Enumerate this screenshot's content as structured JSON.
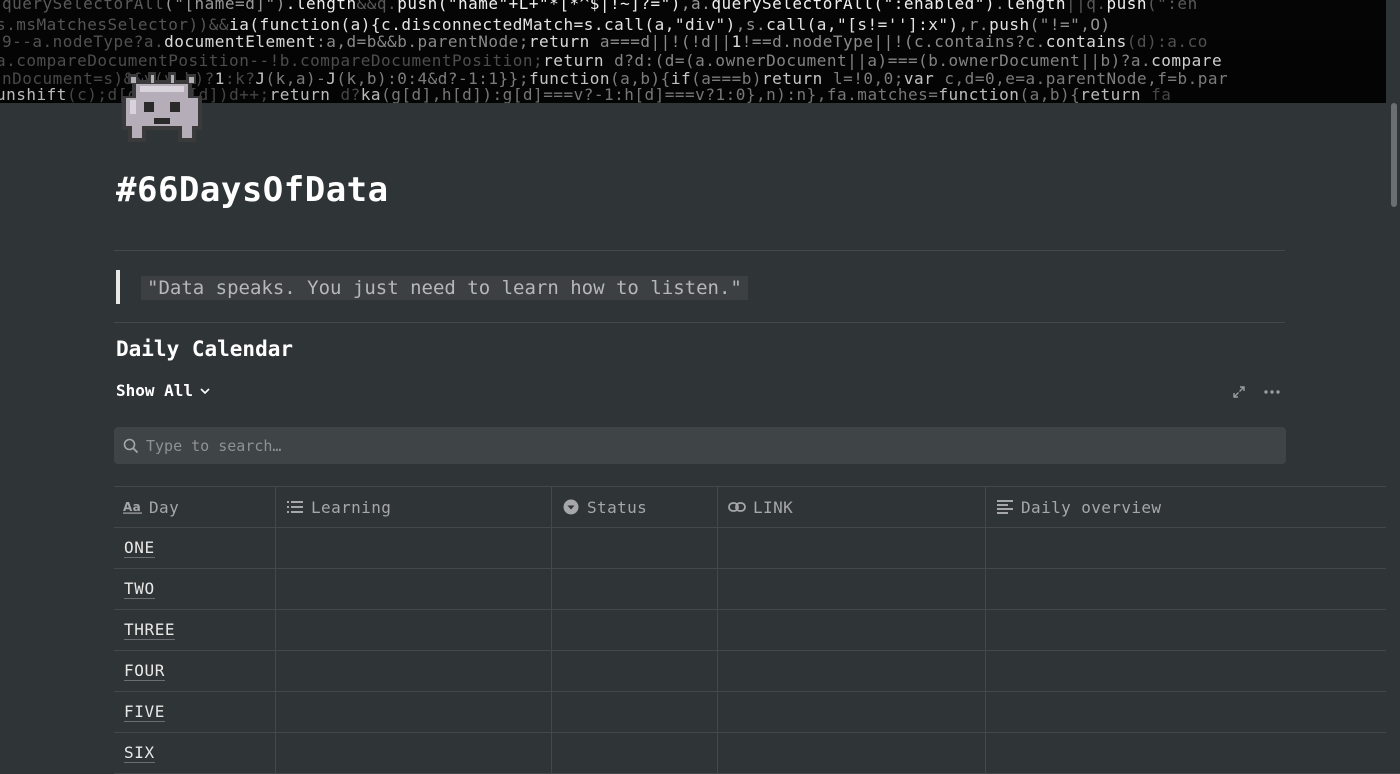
{
  "cover": {
    "code_lines": [
      [
        [
          "dim",
          "  querySelectorAll"
        ],
        [
          "mid",
          "(\"[name=d]\")"
        ],
        [
          "",
          "."
        ],
        [
          "",
          "length"
        ],
        [
          "dim",
          "&&q."
        ],
        [
          "",
          "push"
        ],
        [
          "",
          "(\"name\"+L+\"*[*^$|!~]?=\")"
        ],
        [
          "mid",
          ",a."
        ],
        [
          "",
          "querySelectorAll"
        ],
        [
          "",
          "(\":enabled\")"
        ],
        [
          "mid",
          "."
        ],
        [
          "",
          "length"
        ],
        [
          "dim",
          "||q."
        ],
        [
          "",
          "push"
        ],
        [
          "dim",
          "(\":en"
        ]
      ],
      [
        [
          "dim",
          "s.msMatchesSelector))&&"
        ],
        [
          "",
          "ia"
        ],
        [
          "",
          "(function(a){c.disconnectedMatch=s."
        ],
        [
          "",
          "call"
        ],
        [
          "",
          "(a,\"div\")"
        ],
        [
          "mid",
          ",s."
        ],
        [
          "",
          "call"
        ],
        [
          "",
          "(a,\"[s!='']:x\")"
        ],
        [
          "mid",
          ",r."
        ],
        [
          "",
          "push"
        ],
        [
          "mid",
          "(\"!=\",O)"
        ]
      ],
      [
        [
          "dim",
          "9--a.nodeType?a."
        ],
        [
          "",
          "documentElement"
        ],
        [
          "mid",
          ":a,d=b&&b.parentNode;"
        ],
        [
          "",
          "return"
        ],
        [
          "mid",
          " a===d||!(!d||"
        ],
        [
          "",
          "1"
        ],
        [
          "mid",
          "!==d.nodeType||!(c.contains?c."
        ],
        [
          "",
          "contains"
        ],
        [
          "dim",
          "(d):a.co"
        ]
      ],
      [
        [
          "dim",
          "  a.compareDocumentPosition--!b.compareDocumentPosition;"
        ],
        [
          "",
          "return"
        ],
        [
          "mid",
          " d?d:(d=(a.ownerDocument||a)===(b.ownerDocument||b)?a."
        ],
        [
          "",
          "compare"
        ]
      ],
      [
        [
          "dim",
          "nDocument=s)&&y(v,b)?"
        ],
        [
          "",
          "1"
        ],
        [
          "dim",
          ":k?"
        ],
        [
          "",
          "J"
        ],
        [
          "mid",
          "(k,a)-"
        ],
        [
          "",
          "J"
        ],
        [
          "mid",
          "(k,b):0:4&d?-1:1}};"
        ],
        [
          "",
          "function"
        ],
        [
          "mid",
          "(a,b){"
        ],
        [
          "",
          "if"
        ],
        [
          "mid",
          "(a===b)"
        ],
        [
          "",
          "return"
        ],
        [
          "mid",
          " l=!0,0;"
        ],
        [
          "",
          "var"
        ],
        [
          "mid",
          " c,d=0,e=a.parentNode,f=b.par"
        ]
      ],
      [
        [
          "",
          "unshift"
        ],
        [
          "dim",
          "(c);"
        ],
        [
          "dim",
          "d[d]===h[d])d++;"
        ],
        [
          "",
          "return"
        ],
        [
          "dim",
          " d?"
        ],
        [
          "",
          "ka"
        ],
        [
          "mid",
          "(g[d],h[d]):g[d]===v?-1:h[d]===v?1:0},n):n},fa.matches="
        ],
        [
          "",
          "function"
        ],
        [
          "mid",
          "(a,b){"
        ],
        [
          "",
          "return"
        ],
        [
          "dim",
          " fa"
        ]
      ]
    ]
  },
  "page": {
    "title": "#66DaysOfData",
    "quote": "\"Data speaks. You just need to learn how to listen.\""
  },
  "database": {
    "heading": "Daily Calendar",
    "view_label": "Show All",
    "search_placeholder": "Type to search…",
    "columns": [
      {
        "label": "Day",
        "icon": "text-type-icon"
      },
      {
        "label": "Learning",
        "icon": "list-icon"
      },
      {
        "label": "Status",
        "icon": "status-icon"
      },
      {
        "label": "LINK",
        "icon": "link-icon"
      },
      {
        "label": "Daily overview",
        "icon": "text-lines-icon"
      }
    ],
    "rows": [
      "ONE",
      "TWO",
      "THREE",
      "FOUR",
      "FIVE",
      "SIX"
    ]
  },
  "colors": {
    "background": "#2f3437",
    "border": "#43484b",
    "search_bg": "#3f4447"
  }
}
